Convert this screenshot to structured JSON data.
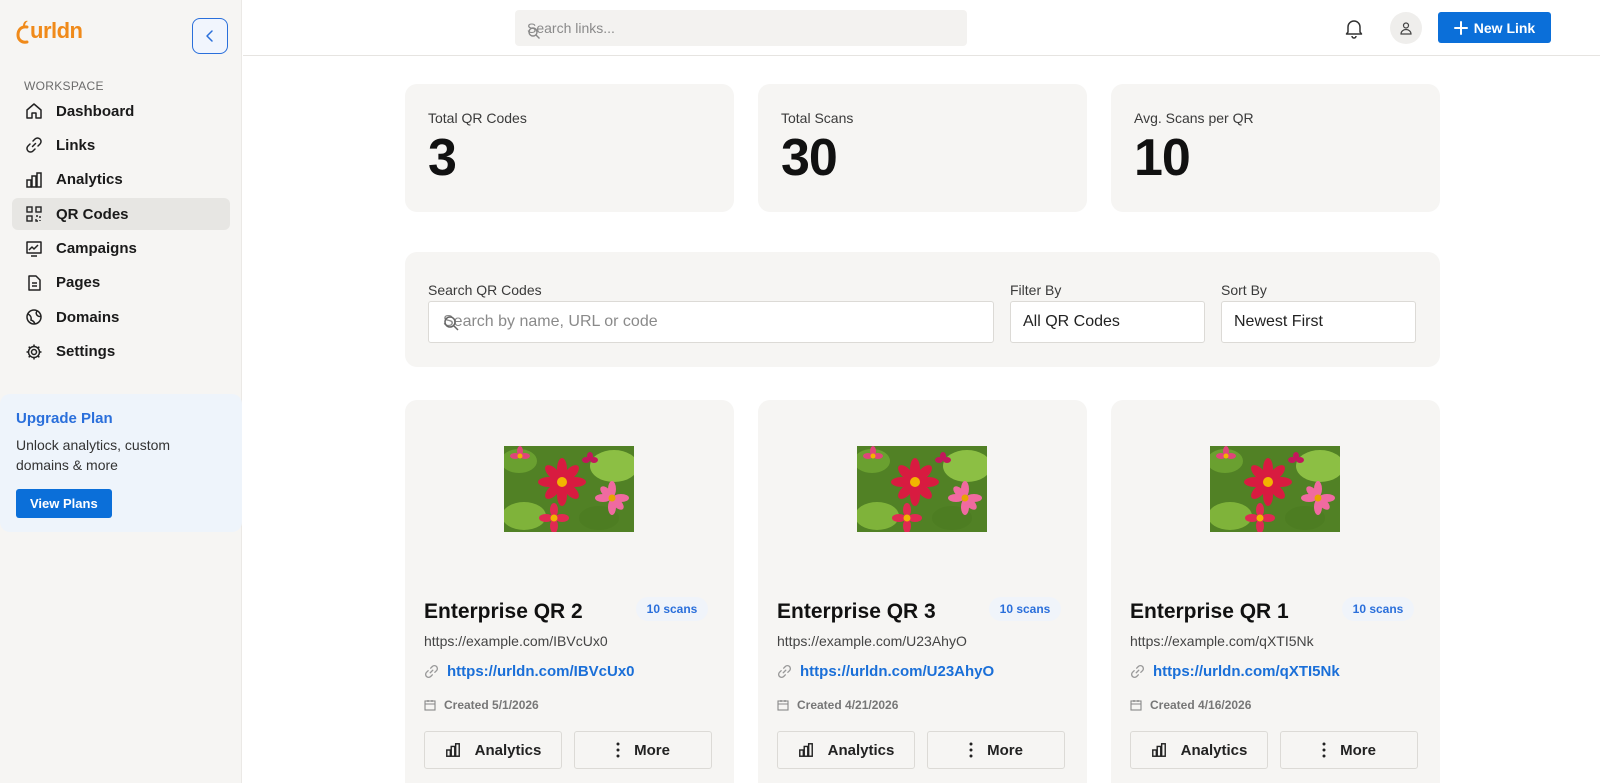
{
  "app": {
    "logo_text": "urldn",
    "brand_color": "#f08a1a",
    "accent_color": "#0b6fd9"
  },
  "sidebar": {
    "section_label": "WORKSPACE",
    "items": [
      {
        "label": "Dashboard",
        "icon": "home-icon"
      },
      {
        "label": "Links",
        "icon": "link-icon"
      },
      {
        "label": "Analytics",
        "icon": "bar-chart-icon"
      },
      {
        "label": "QR Codes",
        "icon": "qr-code-icon",
        "active": true
      },
      {
        "label": "Campaigns",
        "icon": "campaign-icon"
      },
      {
        "label": "Pages",
        "icon": "page-icon"
      },
      {
        "label": "Domains",
        "icon": "globe-icon"
      },
      {
        "label": "Settings",
        "icon": "gear-icon"
      }
    ],
    "upgrade": {
      "title": "Upgrade Plan",
      "description": "Unlock analytics, custom domains & more",
      "button": "View Plans"
    }
  },
  "topbar": {
    "search_placeholder": "Search links...",
    "new_link_label": "New Link"
  },
  "stats": [
    {
      "label": "Total QR Codes",
      "value": "3"
    },
    {
      "label": "Total Scans",
      "value": "30"
    },
    {
      "label": "Avg. Scans per QR",
      "value": "10"
    }
  ],
  "filters": {
    "search_label": "Search QR Codes",
    "search_placeholder": "Search by name, URL or code",
    "filter_label": "Filter By",
    "filter_value": "All QR Codes",
    "sort_label": "Sort By",
    "sort_value": "Newest First"
  },
  "qr_cards": [
    {
      "name": "Enterprise QR 2",
      "scans": "10 scans",
      "destination": "https://example.com/IBVcUx0",
      "short_url": "https://urldn.com/IBVcUx0",
      "created": "Created 5/1/2026",
      "analytics_label": "Analytics",
      "more_label": "More"
    },
    {
      "name": "Enterprise QR 3",
      "scans": "10 scans",
      "destination": "https://example.com/U23AhyO",
      "short_url": "https://urldn.com/U23AhyO",
      "created": "Created 4/21/2026",
      "analytics_label": "Analytics",
      "more_label": "More"
    },
    {
      "name": "Enterprise QR 1",
      "scans": "10 scans",
      "destination": "https://example.com/qXTI5Nk",
      "short_url": "https://urldn.com/qXTI5Nk",
      "created": "Created 4/16/2026",
      "analytics_label": "Analytics",
      "more_label": "More"
    }
  ]
}
